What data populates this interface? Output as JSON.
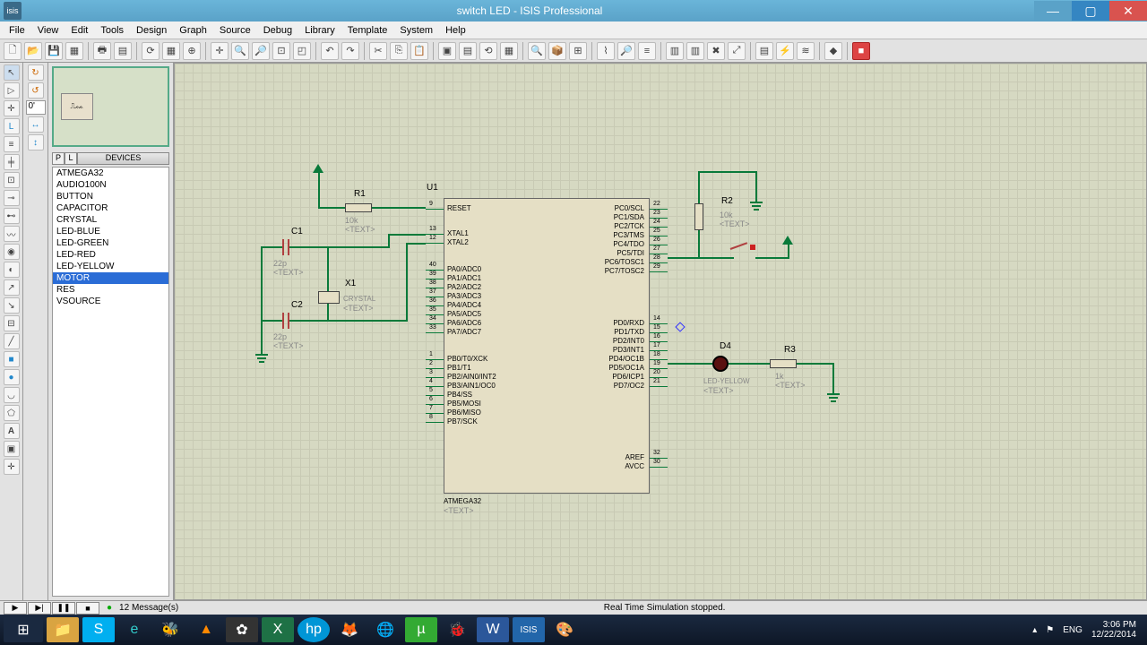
{
  "window": {
    "title": "switch LED - ISIS Professional",
    "app_icon": "isis"
  },
  "menu": [
    "File",
    "View",
    "Edit",
    "Tools",
    "Design",
    "Graph",
    "Source",
    "Debug",
    "Library",
    "Template",
    "System",
    "Help"
  ],
  "side": {
    "coord": "0'",
    "dev_header_p": "P",
    "dev_header_l": "L",
    "dev_header": "DEVICES",
    "devices": [
      "ATMEGA32",
      "AUDIO100N",
      "BUTTON",
      "CAPACITOR",
      "CRYSTAL",
      "LED-BLUE",
      "LED-GREEN",
      "LED-RED",
      "LED-YELLOW",
      "MOTOR",
      "RES",
      "VSOURCE"
    ],
    "selected_index": 9
  },
  "schematic": {
    "u1": {
      "ref": "U1",
      "part": "ATMEGA32",
      "text": "<TEXT>",
      "left_pins": [
        {
          "n": "9",
          "name": "RESET"
        },
        {
          "n": "13",
          "name": "XTAL1"
        },
        {
          "n": "12",
          "name": "XTAL2"
        },
        {
          "n": "40",
          "name": "PA0/ADC0"
        },
        {
          "n": "39",
          "name": "PA1/ADC1"
        },
        {
          "n": "38",
          "name": "PA2/ADC2"
        },
        {
          "n": "37",
          "name": "PA3/ADC3"
        },
        {
          "n": "36",
          "name": "PA4/ADC4"
        },
        {
          "n": "35",
          "name": "PA5/ADC5"
        },
        {
          "n": "34",
          "name": "PA6/ADC6"
        },
        {
          "n": "33",
          "name": "PA7/ADC7"
        },
        {
          "n": "1",
          "name": "PB0/T0/XCK"
        },
        {
          "n": "2",
          "name": "PB1/T1"
        },
        {
          "n": "3",
          "name": "PB2/AIN0/INT2"
        },
        {
          "n": "4",
          "name": "PB3/AIN1/OC0"
        },
        {
          "n": "5",
          "name": "PB4/SS"
        },
        {
          "n": "6",
          "name": "PB5/MOSI"
        },
        {
          "n": "7",
          "name": "PB6/MISO"
        },
        {
          "n": "8",
          "name": "PB7/SCK"
        }
      ],
      "right_pins": [
        {
          "n": "22",
          "name": "PC0/SCL"
        },
        {
          "n": "23",
          "name": "PC1/SDA"
        },
        {
          "n": "24",
          "name": "PC2/TCK"
        },
        {
          "n": "25",
          "name": "PC3/TMS"
        },
        {
          "n": "26",
          "name": "PC4/TDO"
        },
        {
          "n": "27",
          "name": "PC5/TDI"
        },
        {
          "n": "28",
          "name": "PC6/TOSC1"
        },
        {
          "n": "29",
          "name": "PC7/TOSC2"
        },
        {
          "n": "14",
          "name": "PD0/RXD"
        },
        {
          "n": "15",
          "name": "PD1/TXD"
        },
        {
          "n": "16",
          "name": "PD2/INT0"
        },
        {
          "n": "17",
          "name": "PD3/INT1"
        },
        {
          "n": "18",
          "name": "PD4/OC1B"
        },
        {
          "n": "19",
          "name": "PD5/OC1A"
        },
        {
          "n": "20",
          "name": "PD6/ICP1"
        },
        {
          "n": "21",
          "name": "PD7/OC2"
        },
        {
          "n": "32",
          "name": "AREF"
        },
        {
          "n": "30",
          "name": "AVCC"
        }
      ]
    },
    "r1": {
      "ref": "R1",
      "val": "10k",
      "text": "<TEXT>"
    },
    "r2": {
      "ref": "R2",
      "val": "10k",
      "text": "<TEXT>"
    },
    "r3": {
      "ref": "R3",
      "val": "1k",
      "text": "<TEXT>"
    },
    "c1": {
      "ref": "C1",
      "val": "22p",
      "text": "<TEXT>"
    },
    "c2": {
      "ref": "C2",
      "val": "22p",
      "text": "<TEXT>"
    },
    "x1": {
      "ref": "X1",
      "part": "CRYSTAL",
      "text": "<TEXT>"
    },
    "d4": {
      "ref": "D4",
      "part": "LED-YELLOW",
      "text": "<TEXT>"
    }
  },
  "status": {
    "messages": "12 Message(s)",
    "sim": "Real Time Simulation stopped."
  },
  "tray": {
    "lang": "ENG",
    "time": "3:06 PM",
    "date": "12/22/2014"
  }
}
